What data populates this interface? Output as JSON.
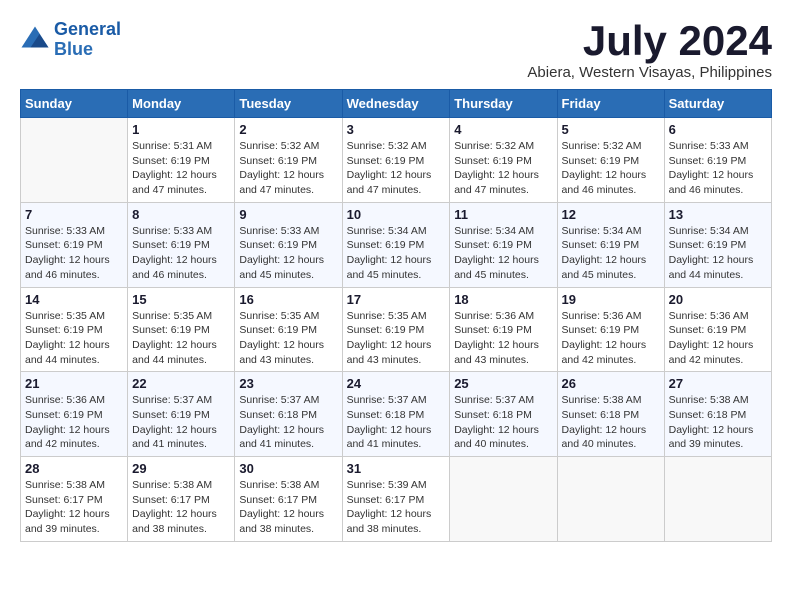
{
  "header": {
    "logo_line1": "General",
    "logo_line2": "Blue",
    "month": "July 2024",
    "location": "Abiera, Western Visayas, Philippines"
  },
  "days_of_week": [
    "Sunday",
    "Monday",
    "Tuesday",
    "Wednesday",
    "Thursday",
    "Friday",
    "Saturday"
  ],
  "weeks": [
    [
      {
        "day": null
      },
      {
        "day": 1,
        "sunrise": "5:31 AM",
        "sunset": "6:19 PM",
        "daylight": "12 hours and 47 minutes."
      },
      {
        "day": 2,
        "sunrise": "5:32 AM",
        "sunset": "6:19 PM",
        "daylight": "12 hours and 47 minutes."
      },
      {
        "day": 3,
        "sunrise": "5:32 AM",
        "sunset": "6:19 PM",
        "daylight": "12 hours and 47 minutes."
      },
      {
        "day": 4,
        "sunrise": "5:32 AM",
        "sunset": "6:19 PM",
        "daylight": "12 hours and 47 minutes."
      },
      {
        "day": 5,
        "sunrise": "5:32 AM",
        "sunset": "6:19 PM",
        "daylight": "12 hours and 46 minutes."
      },
      {
        "day": 6,
        "sunrise": "5:33 AM",
        "sunset": "6:19 PM",
        "daylight": "12 hours and 46 minutes."
      }
    ],
    [
      {
        "day": 7,
        "sunrise": "5:33 AM",
        "sunset": "6:19 PM",
        "daylight": "12 hours and 46 minutes."
      },
      {
        "day": 8,
        "sunrise": "5:33 AM",
        "sunset": "6:19 PM",
        "daylight": "12 hours and 46 minutes."
      },
      {
        "day": 9,
        "sunrise": "5:33 AM",
        "sunset": "6:19 PM",
        "daylight": "12 hours and 45 minutes."
      },
      {
        "day": 10,
        "sunrise": "5:34 AM",
        "sunset": "6:19 PM",
        "daylight": "12 hours and 45 minutes."
      },
      {
        "day": 11,
        "sunrise": "5:34 AM",
        "sunset": "6:19 PM",
        "daylight": "12 hours and 45 minutes."
      },
      {
        "day": 12,
        "sunrise": "5:34 AM",
        "sunset": "6:19 PM",
        "daylight": "12 hours and 45 minutes."
      },
      {
        "day": 13,
        "sunrise": "5:34 AM",
        "sunset": "6:19 PM",
        "daylight": "12 hours and 44 minutes."
      }
    ],
    [
      {
        "day": 14,
        "sunrise": "5:35 AM",
        "sunset": "6:19 PM",
        "daylight": "12 hours and 44 minutes."
      },
      {
        "day": 15,
        "sunrise": "5:35 AM",
        "sunset": "6:19 PM",
        "daylight": "12 hours and 44 minutes."
      },
      {
        "day": 16,
        "sunrise": "5:35 AM",
        "sunset": "6:19 PM",
        "daylight": "12 hours and 43 minutes."
      },
      {
        "day": 17,
        "sunrise": "5:35 AM",
        "sunset": "6:19 PM",
        "daylight": "12 hours and 43 minutes."
      },
      {
        "day": 18,
        "sunrise": "5:36 AM",
        "sunset": "6:19 PM",
        "daylight": "12 hours and 43 minutes."
      },
      {
        "day": 19,
        "sunrise": "5:36 AM",
        "sunset": "6:19 PM",
        "daylight": "12 hours and 42 minutes."
      },
      {
        "day": 20,
        "sunrise": "5:36 AM",
        "sunset": "6:19 PM",
        "daylight": "12 hours and 42 minutes."
      }
    ],
    [
      {
        "day": 21,
        "sunrise": "5:36 AM",
        "sunset": "6:19 PM",
        "daylight": "12 hours and 42 minutes."
      },
      {
        "day": 22,
        "sunrise": "5:37 AM",
        "sunset": "6:19 PM",
        "daylight": "12 hours and 41 minutes."
      },
      {
        "day": 23,
        "sunrise": "5:37 AM",
        "sunset": "6:18 PM",
        "daylight": "12 hours and 41 minutes."
      },
      {
        "day": 24,
        "sunrise": "5:37 AM",
        "sunset": "6:18 PM",
        "daylight": "12 hours and 41 minutes."
      },
      {
        "day": 25,
        "sunrise": "5:37 AM",
        "sunset": "6:18 PM",
        "daylight": "12 hours and 40 minutes."
      },
      {
        "day": 26,
        "sunrise": "5:38 AM",
        "sunset": "6:18 PM",
        "daylight": "12 hours and 40 minutes."
      },
      {
        "day": 27,
        "sunrise": "5:38 AM",
        "sunset": "6:18 PM",
        "daylight": "12 hours and 39 minutes."
      }
    ],
    [
      {
        "day": 28,
        "sunrise": "5:38 AM",
        "sunset": "6:17 PM",
        "daylight": "12 hours and 39 minutes."
      },
      {
        "day": 29,
        "sunrise": "5:38 AM",
        "sunset": "6:17 PM",
        "daylight": "12 hours and 38 minutes."
      },
      {
        "day": 30,
        "sunrise": "5:38 AM",
        "sunset": "6:17 PM",
        "daylight": "12 hours and 38 minutes."
      },
      {
        "day": 31,
        "sunrise": "5:39 AM",
        "sunset": "6:17 PM",
        "daylight": "12 hours and 38 minutes."
      },
      {
        "day": null
      },
      {
        "day": null
      },
      {
        "day": null
      }
    ]
  ]
}
